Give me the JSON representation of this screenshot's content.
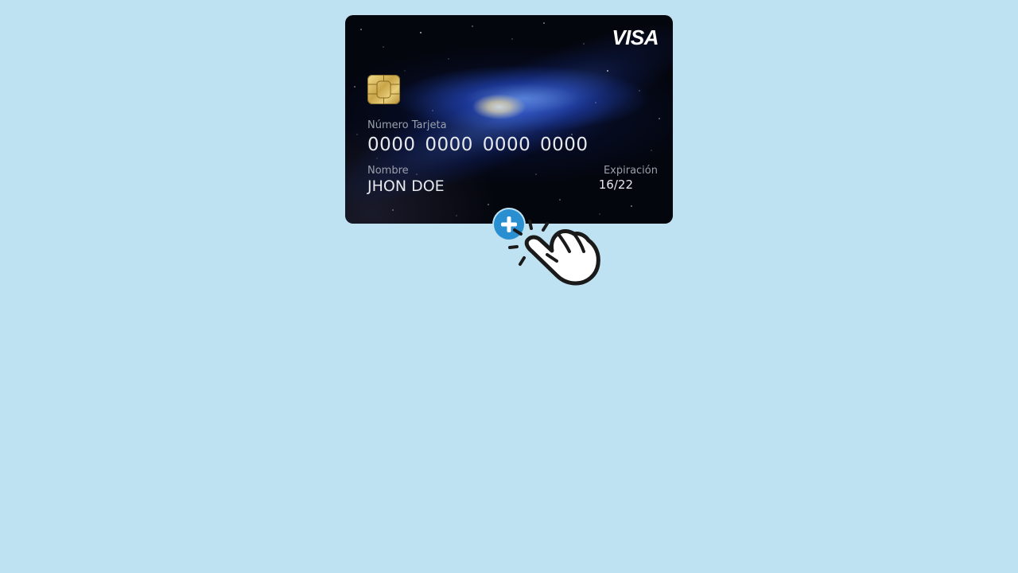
{
  "card": {
    "brand": "VISA",
    "number_label": "Número Tarjeta",
    "number": "0000 0000 0000 0000",
    "name_label": "Nombre",
    "name": "JHON DOE",
    "expiration_label": "Expiración",
    "expiration": "16/22"
  },
  "actions": {
    "add_icon": "plus-icon",
    "pointer_icon": "hand-pointer-icon"
  },
  "colors": {
    "background": "#bfe2f2",
    "add_button": "#2a8fd0"
  }
}
